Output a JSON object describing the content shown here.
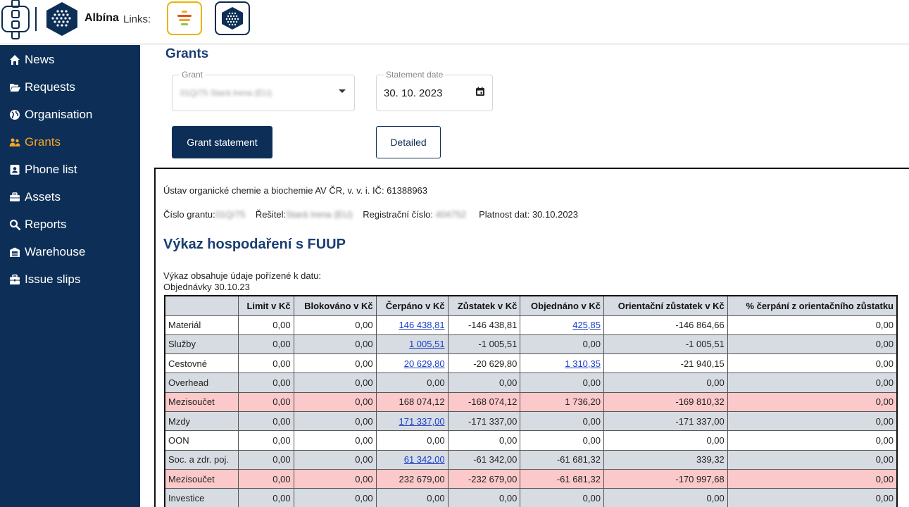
{
  "header": {
    "brand": "Albína",
    "links_label": "Links:"
  },
  "sidebar": {
    "items": [
      {
        "label": "News",
        "icon": "home-icon"
      },
      {
        "label": "Requests",
        "icon": "folder-open-icon"
      },
      {
        "label": "Organisation",
        "icon": "globe-icon"
      },
      {
        "label": "Grants",
        "icon": "users-icon",
        "active": true
      },
      {
        "label": "Phone list",
        "icon": "address-book-icon"
      },
      {
        "label": "Assets",
        "icon": "briefcase-icon"
      },
      {
        "label": "Reports",
        "icon": "search-icon"
      },
      {
        "label": "Warehouse",
        "icon": "warehouse-icon"
      },
      {
        "label": "Issue slips",
        "icon": "toolbox-icon"
      }
    ]
  },
  "main": {
    "title": "Grants",
    "grant_field": {
      "legend": "Grant",
      "value": "01Q/75 Stará Irena (EU)"
    },
    "date_field": {
      "legend": "Statement date",
      "value": "30. 10. 2023"
    },
    "btn_statement": "Grant statement",
    "btn_detailed": "Detailed"
  },
  "report": {
    "institution": "Ústav organické chemie a biochemie AV ČR, v. v. i. IČ: 61388963",
    "grant_no_label": "Číslo grantu:",
    "grant_no_value": "01Q/75",
    "solver_label": "Řešitel:",
    "solver_value": "Stará Irena (EU)",
    "reg_label": "Registrační číslo:",
    "reg_value": "404752",
    "validity": "Platnost dat: 30.10.2023",
    "title": "Výkaz hospodaření s FUUP",
    "note1": "Výkaz obsahuje údaje pořízené k datu:",
    "note2": "Objednávky 30.10.23",
    "columns": [
      "",
      "Limit v Kč",
      "Blokováno v Kč",
      "Čerpáno v Kč",
      "Zůstatek v Kč",
      "Objednáno v Kč",
      "Orientační zůstatek v Kč",
      "% čerpání z orientačního zůstatku"
    ],
    "rows": [
      {
        "style": "w",
        "cells": [
          "Materiál",
          "0,00",
          "0,00",
          "146 438,81",
          "-146 438,81",
          "425,85",
          "-146 864,66",
          "0,00"
        ],
        "links": [
          3,
          5
        ]
      },
      {
        "style": "g",
        "cells": [
          "Služby",
          "0,00",
          "0,00",
          "1 005,51",
          "-1 005,51",
          "0,00",
          "-1 005,51",
          "0,00"
        ],
        "links": [
          3
        ]
      },
      {
        "style": "w",
        "cells": [
          "Cestovné",
          "0,00",
          "0,00",
          "20 629,80",
          "-20 629,80",
          "1 310,35",
          "-21 940,15",
          "0,00"
        ],
        "links": [
          3,
          5
        ]
      },
      {
        "style": "g",
        "cells": [
          "Overhead",
          "0,00",
          "0,00",
          "0,00",
          "0,00",
          "0,00",
          "0,00",
          "0,00"
        ],
        "links": []
      },
      {
        "style": "p",
        "cells": [
          "Mezisoučet",
          "0,00",
          "0,00",
          "168 074,12",
          "-168 074,12",
          "1 736,20",
          "-169 810,32",
          "0,00"
        ],
        "links": []
      },
      {
        "style": "g",
        "cells": [
          "Mzdy",
          "0,00",
          "0,00",
          "171 337,00",
          "-171 337,00",
          "0,00",
          "-171 337,00",
          "0,00"
        ],
        "links": [
          3
        ]
      },
      {
        "style": "w",
        "cells": [
          "OON",
          "0,00",
          "0,00",
          "0,00",
          "0,00",
          "0,00",
          "0,00",
          "0,00"
        ],
        "links": []
      },
      {
        "style": "g",
        "cells": [
          "Soc. a zdr. poj.",
          "0,00",
          "0,00",
          "61 342,00",
          "-61 342,00",
          "-61 681,32",
          "339,32",
          "0,00"
        ],
        "links": [
          3
        ]
      },
      {
        "style": "p",
        "cells": [
          "Mezisoučet",
          "0,00",
          "0,00",
          "232 679,00",
          "-232 679,00",
          "-61 681,32",
          "-170 997,68",
          "0,00"
        ],
        "links": []
      },
      {
        "style": "g",
        "cells": [
          "Investice",
          "0,00",
          "0,00",
          "0,00",
          "0,00",
          "0,00",
          "0,00",
          "0,00"
        ],
        "links": []
      }
    ]
  },
  "colors": {
    "sidebar_bg": "#0d2f57",
    "active_nav": "#f5a623",
    "title_blue": "#1b3e73",
    "row_gray": "#d7dce3",
    "row_pink": "#fbc9c9",
    "link_blue": "#1a3fc9"
  }
}
